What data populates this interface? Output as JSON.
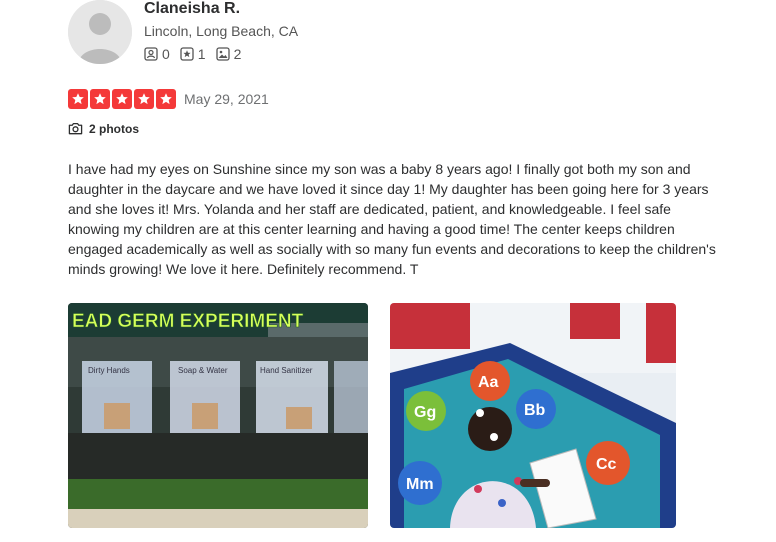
{
  "user": {
    "name": "Claneisha R.",
    "location": "Lincoln, Long Beach, CA",
    "friends_count": "0",
    "reviews_count": "1",
    "photos_count": "2"
  },
  "review": {
    "rating": 5,
    "rating_max": 5,
    "date": "May 29, 2021",
    "photos_label": "2 photos",
    "text": "I have had my eyes on Sunshine since my son was a baby 8 years ago! I finally got both my son and daughter in the daycare and we have loved it since day 1! My daughter has been going here for 3 years and she loves it! Mrs. Yolanda and her staff are dedicated, patient, and knowledgeable. I feel safe knowing my children are at this center learning and having a good time! The center keeps children engaged academically as well as socially with so many fun events and decorations to keep the children's minds growing! We love it here. Definitely recommend. T"
  },
  "photos": [
    {
      "sign_text": "EAD  GERM  EXPERIMENT",
      "bag_labels": [
        "Dirty Hands",
        "Soap & Water",
        "Hand Sanitizer"
      ]
    },
    {
      "rug_letters": [
        "Aa",
        "Bb",
        "Gg",
        "Cc",
        "Mm"
      ]
    }
  ],
  "colors": {
    "star_red": "#f43939",
    "text_dark": "#2d2e2f",
    "text_muted": "#6e7072"
  }
}
